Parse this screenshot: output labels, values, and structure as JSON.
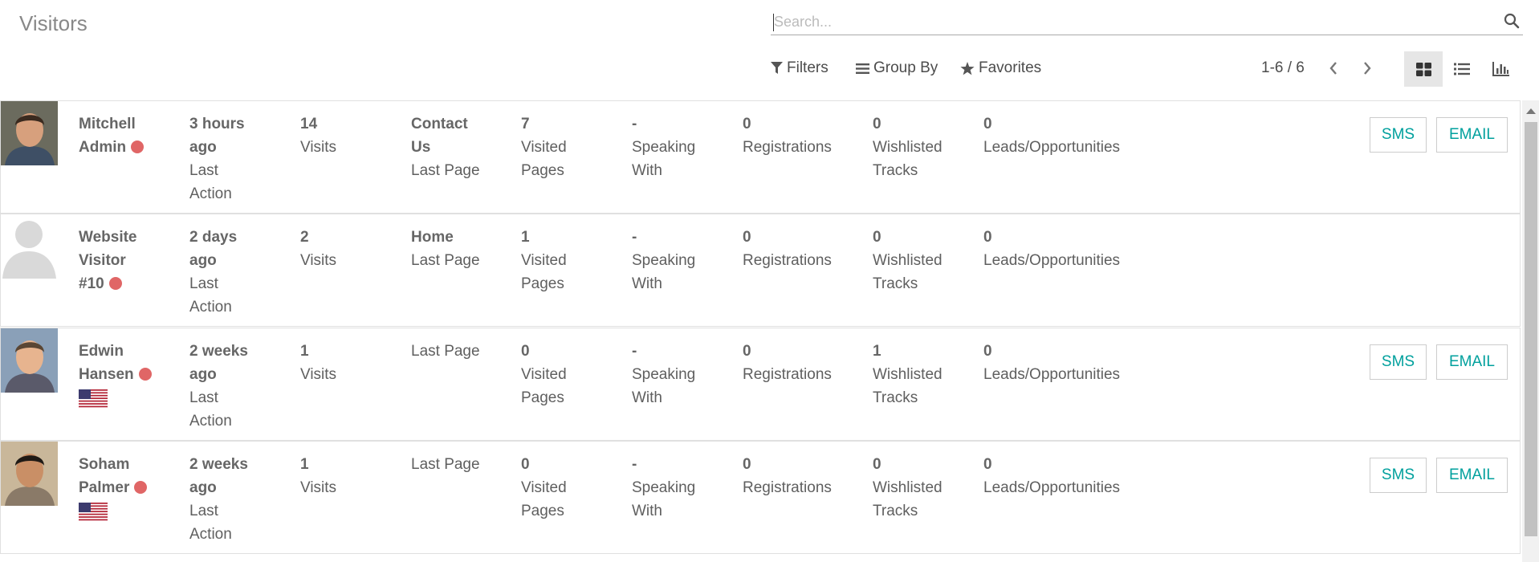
{
  "page": {
    "title": "Visitors"
  },
  "search": {
    "placeholder": "Search..."
  },
  "filters": {
    "filters_label": "Filters",
    "groupby_label": "Group By",
    "favorites_label": "Favorites"
  },
  "pager": {
    "text": "1-6 / 6"
  },
  "views": [
    "kanban-view",
    "list-view",
    "graph-view"
  ],
  "colors": {
    "accent": "#00a09d",
    "online_dot": "#e06666",
    "text": "#4c4c4c"
  },
  "records": [
    {
      "name_lines": [
        "Mitchell",
        "Admin"
      ],
      "online": true,
      "flag": false,
      "avatar": "photo",
      "last_action_value": [
        "3 hours",
        "ago"
      ],
      "last_action_label": [
        "Last",
        "Action"
      ],
      "visits_value": "14",
      "visits_label": "Visits",
      "last_page_value": [
        "Contact",
        "Us"
      ],
      "last_page_label": "Last Page",
      "visited_pages_value": "7",
      "visited_pages_label": [
        "Visited",
        "Pages"
      ],
      "speaking_value": "-",
      "speaking_label": [
        "Speaking",
        "With"
      ],
      "registrations_value": "0",
      "registrations_label": "Registrations",
      "wishlisted_value": "0",
      "wishlisted_label": [
        "Wishlisted",
        "Tracks"
      ],
      "leads_value": "0",
      "leads_label": "Leads/Opportunities",
      "sms_label": "SMS",
      "email_label": "EMAIL",
      "has_buttons": true
    },
    {
      "name_lines": [
        "Website",
        "Visitor",
        "#10"
      ],
      "online": true,
      "flag": false,
      "avatar": "placeholder",
      "last_action_value": [
        "2 days",
        "ago"
      ],
      "last_action_label": [
        "Last",
        "Action"
      ],
      "visits_value": "2",
      "visits_label": "Visits",
      "last_page_value": [
        "Home"
      ],
      "last_page_label": "Last Page",
      "visited_pages_value": "1",
      "visited_pages_label": [
        "Visited",
        "Pages"
      ],
      "speaking_value": "-",
      "speaking_label": [
        "Speaking",
        "With"
      ],
      "registrations_value": "0",
      "registrations_label": "Registrations",
      "wishlisted_value": "0",
      "wishlisted_label": [
        "Wishlisted",
        "Tracks"
      ],
      "leads_value": "0",
      "leads_label": "Leads/Opportunities",
      "has_buttons": false
    },
    {
      "name_lines": [
        "Edwin",
        "Hansen"
      ],
      "online": true,
      "flag": true,
      "avatar": "photo",
      "last_action_value": [
        "2 weeks",
        "ago"
      ],
      "last_action_label": [
        "Last",
        "Action"
      ],
      "visits_value": "1",
      "visits_label": "Visits",
      "last_page_value": [],
      "last_page_label": "Last Page",
      "visited_pages_value": "0",
      "visited_pages_label": [
        "Visited",
        "Pages"
      ],
      "speaking_value": "-",
      "speaking_label": [
        "Speaking",
        "With"
      ],
      "registrations_value": "0",
      "registrations_label": "Registrations",
      "wishlisted_value": "1",
      "wishlisted_label": [
        "Wishlisted",
        "Tracks"
      ],
      "leads_value": "0",
      "leads_label": "Leads/Opportunities",
      "sms_label": "SMS",
      "email_label": "EMAIL",
      "has_buttons": true
    },
    {
      "name_lines": [
        "Soham",
        "Palmer"
      ],
      "online": true,
      "flag": true,
      "avatar": "photo",
      "last_action_value": [
        "2 weeks",
        "ago"
      ],
      "last_action_label": [
        "Last",
        "Action"
      ],
      "visits_value": "1",
      "visits_label": "Visits",
      "last_page_value": [],
      "last_page_label": "Last Page",
      "visited_pages_value": "0",
      "visited_pages_label": [
        "Visited",
        "Pages"
      ],
      "speaking_value": "-",
      "speaking_label": [
        "Speaking",
        "With"
      ],
      "registrations_value": "0",
      "registrations_label": "Registrations",
      "wishlisted_value": "0",
      "wishlisted_label": [
        "Wishlisted",
        "Tracks"
      ],
      "leads_value": "0",
      "leads_label": "Leads/Opportunities",
      "sms_label": "SMS",
      "email_label": "EMAIL",
      "has_buttons": true
    }
  ]
}
